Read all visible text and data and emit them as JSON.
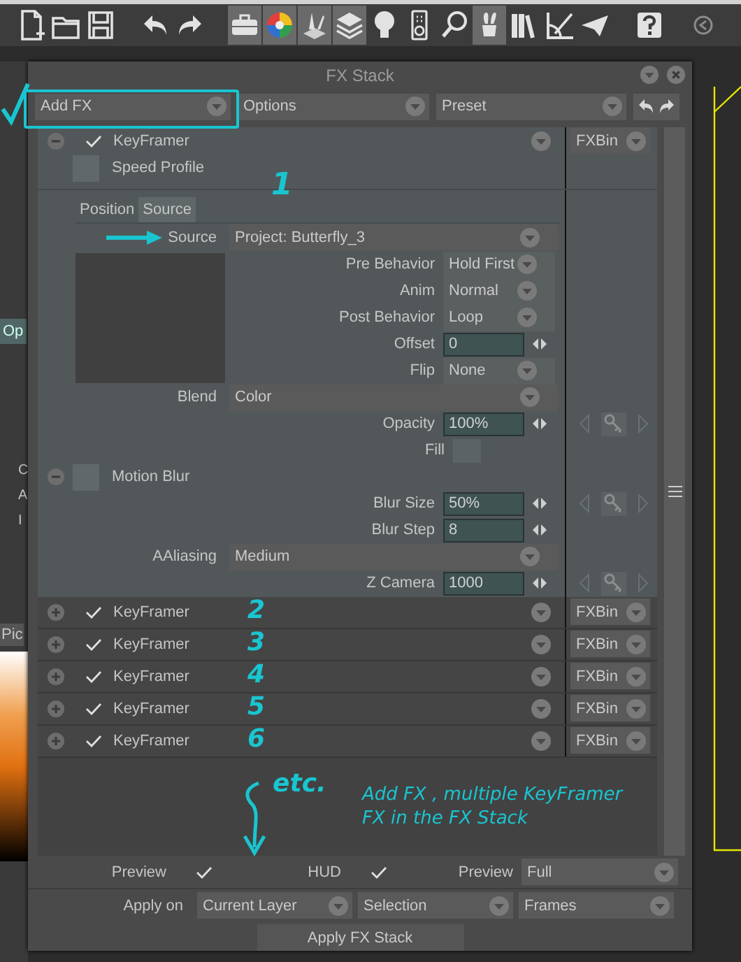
{
  "toolbar": {
    "icons": [
      {
        "kind": "newfile",
        "selected": false
      },
      {
        "kind": "open",
        "selected": false
      },
      {
        "kind": "save",
        "selected": false
      },
      {
        "kind": "undo",
        "selected": false
      },
      {
        "kind": "redo",
        "selected": false
      },
      {
        "kind": "toolbox",
        "selected": true
      },
      {
        "kind": "colorwheel",
        "selected": true
      },
      {
        "kind": "brush",
        "selected": true
      },
      {
        "kind": "layers",
        "selected": true
      },
      {
        "kind": "bulb",
        "selected": false
      },
      {
        "kind": "remote",
        "selected": false
      },
      {
        "kind": "search",
        "selected": false
      },
      {
        "kind": "hat",
        "selected": true
      },
      {
        "kind": "books",
        "selected": false
      },
      {
        "kind": "ruler",
        "selected": false
      },
      {
        "kind": "plane",
        "selected": false
      },
      {
        "kind": "help",
        "selected": false
      },
      {
        "kind": "back",
        "selected": false
      }
    ]
  },
  "side_panel": {
    "tab": "Op",
    "letters": [
      "C",
      "A",
      "I"
    ],
    "picker_tab": "Pic"
  },
  "window": {
    "title": "FX Stack"
  },
  "top_bar": {
    "dropdowns": [
      "Add FX",
      "Options",
      "Preset"
    ]
  },
  "fx_stack": [
    {
      "name": "KeyFramer",
      "enabled": true,
      "expanded": true,
      "bin": "FXBin",
      "speed_profile": {
        "label": "Speed Profile",
        "checked": false
      },
      "tabs": [
        {
          "label": "Position",
          "selected": false
        },
        {
          "label": "Source",
          "selected": true
        }
      ],
      "note": "1",
      "source": {
        "label": "Source",
        "value": "Project: Butterfly_3"
      },
      "behavior": [
        {
          "kind": "select",
          "label": "Pre Behavior",
          "value": "Hold First"
        },
        {
          "kind": "select",
          "label": "Anim",
          "value": "Normal"
        },
        {
          "kind": "select",
          "label": "Post Behavior",
          "value": "Loop"
        },
        {
          "kind": "number",
          "label": "Offset",
          "value": "0",
          "keyframe": false
        },
        {
          "kind": "select",
          "label": "Flip",
          "value": "None"
        }
      ],
      "params": [
        {
          "kind": "wideselect",
          "label": "Blend",
          "value": "Color"
        },
        {
          "kind": "number",
          "label": "Opacity",
          "value": "100%",
          "keyframe": true
        },
        {
          "kind": "swatch",
          "label": "Fill"
        },
        {
          "kind": "section",
          "label": "Motion Blur",
          "checked": false,
          "expanded": true
        },
        {
          "kind": "number",
          "label": "Blur Size",
          "value": "50%",
          "keyframe": true
        },
        {
          "kind": "number",
          "label": "Blur Step",
          "value": "8",
          "keyframe": false
        },
        {
          "kind": "wideselect",
          "label": "AAliasing",
          "value": "Medium"
        },
        {
          "kind": "number",
          "label": "Z Camera",
          "value": "1000",
          "keyframe": true
        }
      ]
    },
    {
      "name": "KeyFramer",
      "enabled": true,
      "expanded": false,
      "bin": "FXBin",
      "note": "2"
    },
    {
      "name": "KeyFramer",
      "enabled": true,
      "expanded": false,
      "bin": "FXBin",
      "note": "3"
    },
    {
      "name": "KeyFramer",
      "enabled": true,
      "expanded": false,
      "bin": "FXBin",
      "note": "4"
    },
    {
      "name": "KeyFramer",
      "enabled": true,
      "expanded": false,
      "bin": "FXBin",
      "note": "5"
    },
    {
      "name": "KeyFramer",
      "enabled": true,
      "expanded": false,
      "bin": "FXBin",
      "note": "6"
    }
  ],
  "stack_notes": {
    "etc": "etc.",
    "caption": "Add FX , multiple KeyFramer FX in the FX Stack"
  },
  "options": {
    "preview": {
      "label": "Preview",
      "checked": true
    },
    "hud": {
      "label": "HUD",
      "checked": true
    },
    "preview_mode": {
      "label": "Preview",
      "value": "Full"
    }
  },
  "apply": {
    "label": "Apply on",
    "selects": [
      "Current Layer",
      "Selection",
      "Frames"
    ],
    "button": "Apply FX Stack"
  }
}
